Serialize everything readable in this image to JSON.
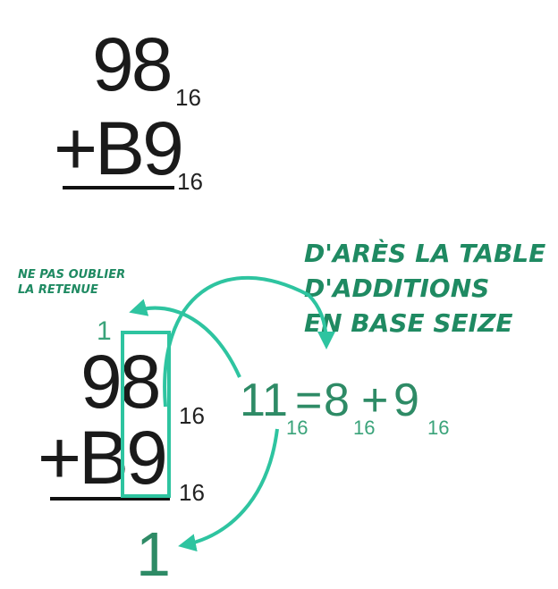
{
  "colors": {
    "accent": "#2ec4a0",
    "text_green": "#2e8b66",
    "ink": "#1a1a1a"
  },
  "top_problem": {
    "line1": "98",
    "line1_base": "16",
    "line2": "+B9",
    "line2_base": "16"
  },
  "annotations": {
    "carry_note_1": "NE PAS OUBLIER",
    "carry_note_2": "LA RETENUE",
    "table_note_1": "D'ARÈS LA TABLE",
    "table_note_2": "D'ADDITIONS",
    "table_note_3": "EN BASE SEIZE"
  },
  "bottom_problem": {
    "carry": "1",
    "line1": "98",
    "line1_base": "16",
    "line2": "+B9",
    "line2_base": "16",
    "result": "1"
  },
  "equation": {
    "sum": "11",
    "sum_base": "16",
    "equals": "=",
    "a": "8",
    "a_base": "16",
    "plus": "+",
    "b": "9",
    "b_base": "16"
  }
}
